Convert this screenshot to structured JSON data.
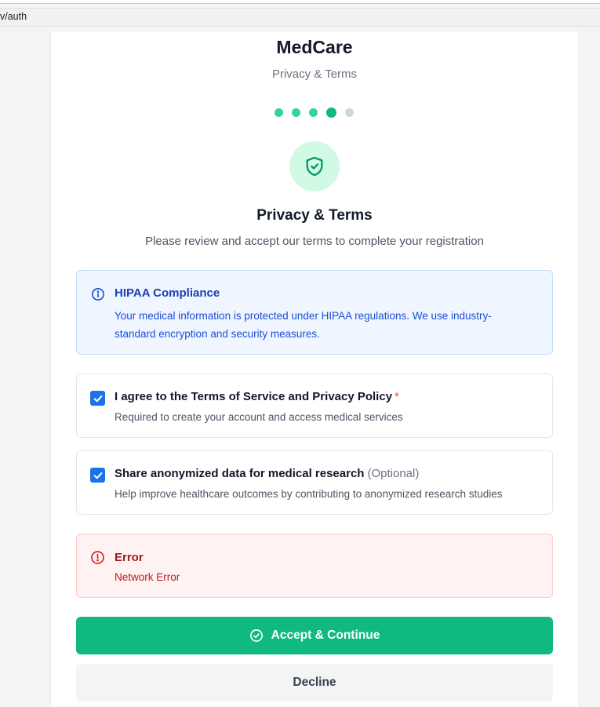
{
  "browser": {
    "url": "v/auth"
  },
  "header": {
    "brand": "MedCare",
    "subtitle": "Privacy & Terms"
  },
  "steps": {
    "total": 5,
    "current": 4
  },
  "section": {
    "icon": "shield-check-icon",
    "title": "Privacy & Terms",
    "description": "Please review and accept our terms to complete your registration"
  },
  "notice": {
    "icon": "info-icon",
    "title": "HIPAA Compliance",
    "text": "Your medical information is protected under HIPAA regulations. We use industry-standard encryption and security measures."
  },
  "agreements": [
    {
      "label": "I agree to the Terms of Service and Privacy Policy",
      "required_marker": "*",
      "description": "Required to create your account and access medical services",
      "checked": true
    },
    {
      "label": "Share anonymized data for medical research",
      "optional_tag": "(Optional)",
      "description": "Help improve healthcare outcomes by contributing to anonymized research studies",
      "checked": true
    }
  ],
  "error": {
    "icon": "alert-circle-icon",
    "title": "Error",
    "message": "Network Error"
  },
  "actions": {
    "accept_label": "Accept & Continue",
    "accept_icon": "check-circle-icon",
    "decline_label": "Decline"
  },
  "colors": {
    "primary": "#10b981",
    "info_bg": "#eff6ff",
    "info_text": "#1d4ed8",
    "error_bg": "#fef2f2",
    "error_text": "#b91c1c",
    "checkbox": "#1a73e8"
  }
}
